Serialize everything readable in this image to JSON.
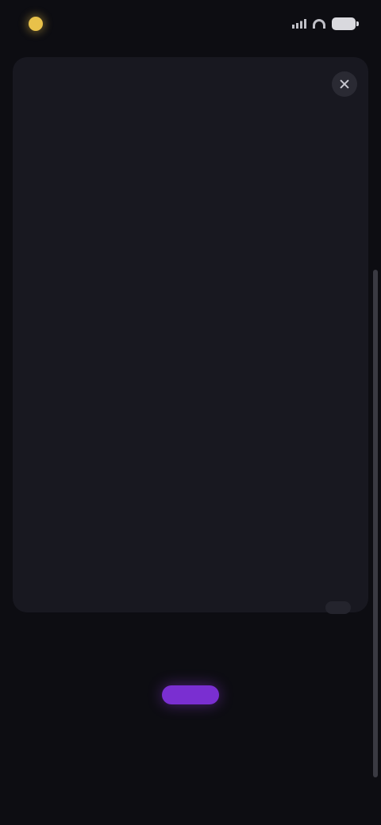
{
  "status_bar": {
    "time": ""
  },
  "panel": {
    "title": "",
    "rows": [
      {
        "label": "",
        "value": ""
      },
      {
        "label": "",
        "value": ""
      },
      {
        "label": "",
        "value": ""
      },
      {
        "label": "",
        "value": ""
      },
      {
        "label": "",
        "value": ""
      },
      {
        "label": "",
        "value": ""
      },
      {
        "label": "",
        "value": ""
      },
      {
        "label": "",
        "value": ""
      },
      {
        "label": "",
        "value": ""
      },
      {
        "label": "",
        "value": ""
      },
      {
        "label": "",
        "value": ""
      }
    ]
  },
  "footer": {
    "text": "",
    "button_label": ""
  },
  "colors": {
    "background": "#0d0d12",
    "panel": "#181820",
    "accent": "#7a2fd1",
    "status_icon": "#e8c14a"
  },
  "icons": [
    "sun-icon",
    "signal-icon",
    "wifi-icon",
    "battery-icon",
    "close-icon"
  ]
}
